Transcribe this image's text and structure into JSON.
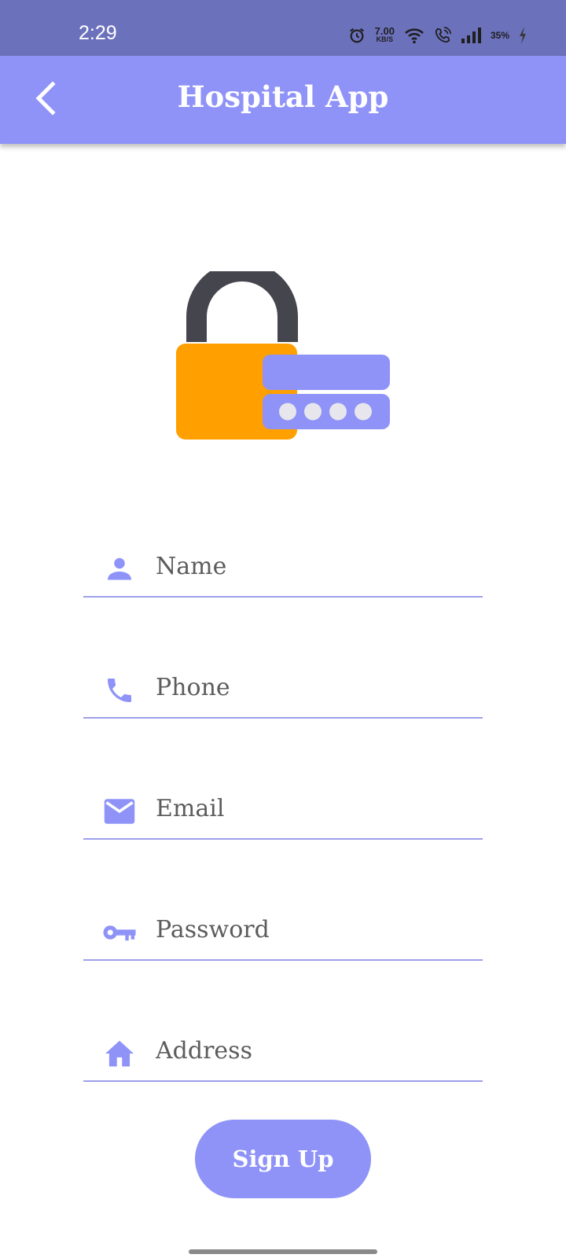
{
  "status_bar": {
    "time": "2:29",
    "net_speed_value": "7.00",
    "net_speed_unit": "KB/S",
    "battery": "35%",
    "icons": [
      "alarm-icon",
      "wifi-icon",
      "wifi-call-icon",
      "signal-icon",
      "battery-charging-icon"
    ]
  },
  "app_bar": {
    "title": "Hospital App",
    "back_icon": "chevron-left-icon"
  },
  "form": {
    "fields": [
      {
        "name": "name",
        "placeholder": "Name",
        "icon": "person-icon",
        "value": ""
      },
      {
        "name": "phone",
        "placeholder": "Phone",
        "icon": "phone-icon",
        "value": ""
      },
      {
        "name": "email",
        "placeholder": "Email",
        "icon": "mail-icon",
        "value": ""
      },
      {
        "name": "password",
        "placeholder": "Password",
        "icon": "key-icon",
        "value": ""
      },
      {
        "name": "address",
        "placeholder": "Address",
        "icon": "home-icon",
        "value": ""
      }
    ],
    "submit_label": "Sign Up"
  },
  "colors": {
    "status_bar": "#6c71bc",
    "accent": "#8f93f7",
    "lock_body": "#ffa000",
    "lock_shackle": "#45454d",
    "input_underline": "#9da0ea"
  }
}
